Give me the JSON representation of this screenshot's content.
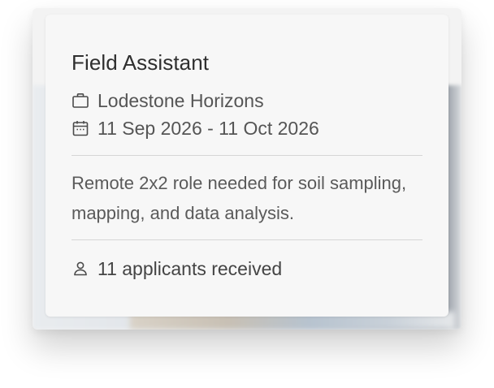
{
  "job": {
    "title": "Field Assistant",
    "company": "Lodestone Horizons",
    "company_icon": "briefcase-icon",
    "dates": "11 Sep 2026 - 11 Oct 2026",
    "dates_icon": "calendar-icon",
    "description": "Remote 2x2 role needed for soil sampling, mapping, and data analysis.",
    "applicants": "11 applicants received",
    "applicants_icon": "person-icon"
  },
  "colors": {
    "card_background": "#f7f7f7",
    "title_text": "#2f2f2f",
    "body_text": "#5a5a5a",
    "divider": "#d6d6d6"
  }
}
